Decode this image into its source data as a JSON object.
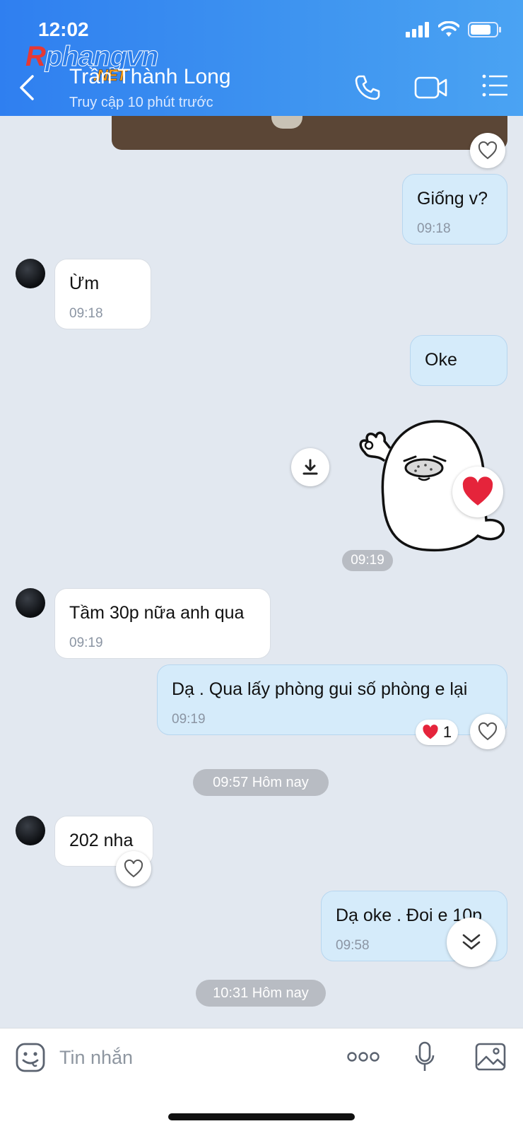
{
  "status_bar": {
    "time": "12:02"
  },
  "watermark": {
    "main": "Rphangvn",
    "sub": ".NET"
  },
  "header": {
    "contact_name": "Trần Thành Long",
    "status": "Truy cập 10 phút trước"
  },
  "messages": [
    {
      "dir": "out",
      "text": "Giống v?",
      "time": "09:18"
    },
    {
      "dir": "in",
      "text": "Ừm",
      "time": "09:18"
    },
    {
      "dir": "out",
      "text": "Oke",
      "time": ""
    },
    {
      "dir": "out",
      "type": "sticker",
      "sticker": "seal-ok-sticker",
      "time": "09:19",
      "reaction": "heart"
    },
    {
      "dir": "in",
      "text": "Tầm 30p nữa anh qua",
      "time": "09:19"
    },
    {
      "dir": "out",
      "text": "Dạ . Qua lấy phòng gui số phòng e lại",
      "time": "09:19",
      "reaction_count": "1"
    },
    {
      "dir": "in",
      "text": "202 nha",
      "time": ""
    },
    {
      "dir": "out",
      "text": "Dạ oke . Đoi e 10p",
      "time": "09:58"
    }
  ],
  "separators": [
    "09:57 Hôm nay",
    "10:31 Hôm nay"
  ],
  "input": {
    "placeholder": "Tin nhắn"
  },
  "colors": {
    "header_start": "#2f7ff0",
    "header_end": "#4aa3f3",
    "outgoing_bubble": "#d5ebfa",
    "incoming_bubble": "#ffffff",
    "chat_bg": "#e2e8f0",
    "heart": "#e5243b"
  }
}
